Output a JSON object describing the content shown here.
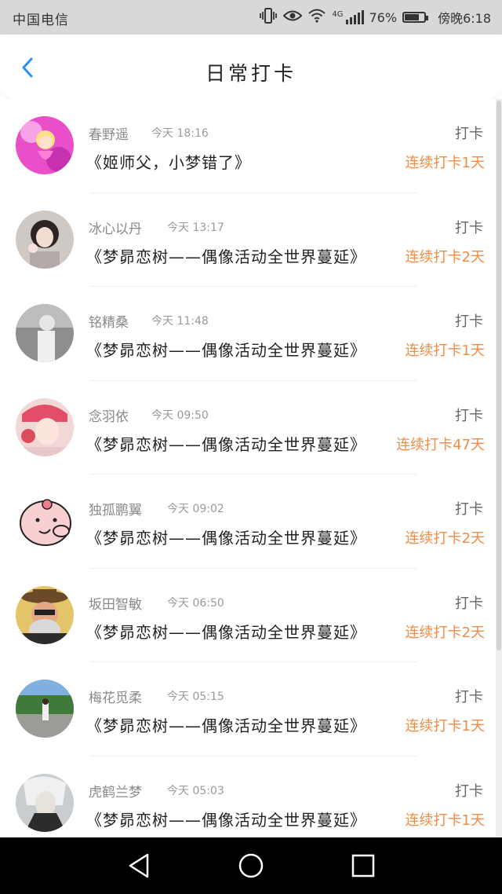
{
  "status_bar": {
    "carrier": "中国电信",
    "network": "4G",
    "battery_percent": "76%",
    "battery_level": 0.76,
    "time": "傍晚6:18",
    "icons": [
      "vibrate-icon",
      "eye-icon",
      "wifi-icon",
      "signal-icon",
      "battery-icon"
    ]
  },
  "header": {
    "title": "日常打卡",
    "back_icon": "chevron-left-icon",
    "accent_color": "#2a8ff7"
  },
  "checkins": [
    {
      "name": "春野遥",
      "time": "今天 18:16",
      "action": "打卡",
      "message": "《姬师父，小梦错了》",
      "streak": "连续打卡1天"
    },
    {
      "name": "冰心以丹",
      "time": "今天 13:17",
      "action": "打卡",
      "message": "《梦昴恋树——偶像活动全世界蔓延》",
      "streak": "连续打卡2天"
    },
    {
      "name": "铭精桑",
      "time": "今天 11:48",
      "action": "打卡",
      "message": "《梦昴恋树——偶像活动全世界蔓延》",
      "streak": "连续打卡1天"
    },
    {
      "name": "念羽依",
      "time": "今天 09:50",
      "action": "打卡",
      "message": "《梦昴恋树——偶像活动全世界蔓延》",
      "streak": "连续打卡47天"
    },
    {
      "name": "独孤鹏翼",
      "time": "今天 09:02",
      "action": "打卡",
      "message": "《梦昴恋树——偶像活动全世界蔓延》",
      "streak": "连续打卡2天"
    },
    {
      "name": "坂田智敏",
      "time": "今天 06:50",
      "action": "打卡",
      "message": "《梦昴恋树——偶像活动全世界蔓延》",
      "streak": "连续打卡2天"
    },
    {
      "name": "梅花觅柔",
      "time": "今天 05:15",
      "action": "打卡",
      "message": "《梦昴恋树——偶像活动全世界蔓延》",
      "streak": "连续打卡1天"
    },
    {
      "name": "虎鹤兰梦",
      "time": "今天 05:03",
      "action": "打卡",
      "message": "《梦昴恋树——偶像活动全世界蔓延》",
      "streak": "连续打卡1天"
    }
  ],
  "colors": {
    "streak": "#f08c43",
    "status_bar_bg": "#d8d8d8",
    "nav_bar_bg": "#000000"
  },
  "nav_bar": {
    "icons": [
      "back-triangle-icon",
      "home-circle-icon",
      "recents-square-icon"
    ]
  }
}
